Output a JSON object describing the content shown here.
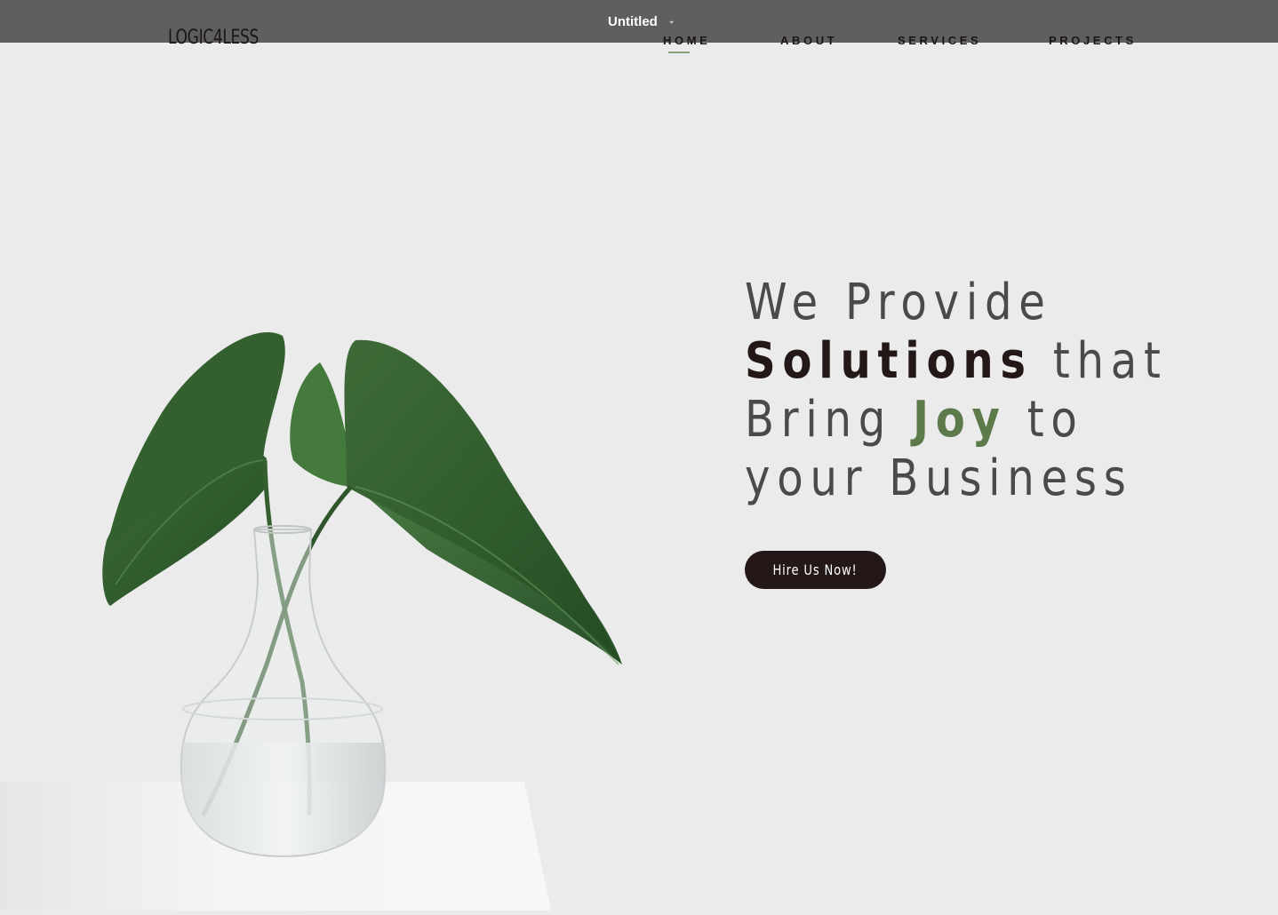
{
  "window": {
    "title": "Untitled",
    "chevron_icon": "chevron-down-icon"
  },
  "site": {
    "logo": "LOGIC4LESS",
    "nav": [
      {
        "label": "HOME",
        "active": true
      },
      {
        "label": "ABOUT",
        "active": false
      },
      {
        "label": "SERVICES",
        "active": false
      },
      {
        "label": "PROJECTS",
        "active": false
      }
    ]
  },
  "hero": {
    "line1": "We Provide",
    "line2_strong": "Solutions",
    "line2_rest": " that",
    "line3_start": "Bring ",
    "line3_accent": "Joy",
    "line3_rest": " to",
    "line4": "your Business",
    "button_label": "Hire Us Now!",
    "image_subject": "plant-in-glass-vase"
  },
  "colors": {
    "background": "#ebebeb",
    "window_bar": "#5f5f5f",
    "dark": "#231718",
    "accent_green": "#5c7a4a",
    "nav_underline": "#8aa07f"
  }
}
